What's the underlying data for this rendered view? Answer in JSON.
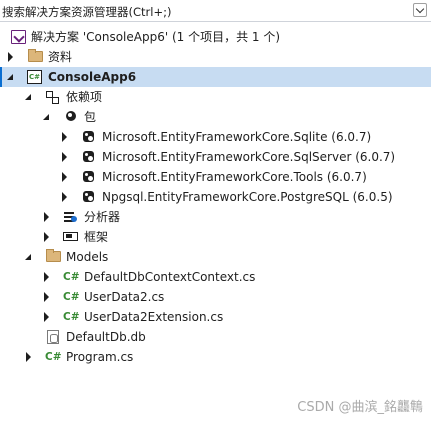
{
  "search": {
    "placeholder": "搜索解决方案资源管理器(Ctrl+;)"
  },
  "tree": {
    "solution": {
      "label": "解决方案 'ConsoleApp6' (1 个项目，共 1 个)"
    },
    "ziliao": {
      "label": "资料"
    },
    "project": {
      "label": "ConsoleApp6"
    },
    "deps": {
      "label": "依赖项"
    },
    "packages": {
      "label": "包",
      "items": [
        "Microsoft.EntityFrameworkCore.Sqlite (6.0.7)",
        "Microsoft.EntityFrameworkCore.SqlServer (6.0.7)",
        "Microsoft.EntityFrameworkCore.Tools (6.0.7)",
        "Npgsql.EntityFrameworkCore.PostgreSQL (6.0.5)"
      ]
    },
    "analyzers": {
      "label": "分析器"
    },
    "frameworks": {
      "label": "框架"
    },
    "models": {
      "label": "Models",
      "items": [
        "DefaultDbContextContext.cs",
        "UserData2.cs",
        "UserData2Extension.cs"
      ]
    },
    "defaultdb": {
      "label": "DefaultDb.db"
    },
    "program": {
      "label": "Program.cs"
    },
    "cs_icon_text": "C#",
    "csproj_icon_text": "C#"
  },
  "watermark": "CSDN @曲滨_銘龘鶽",
  "colors": {
    "selection": "#c7dcf2",
    "accent": "#0a6ed1",
    "cs_green": "#388a34",
    "solution_purple": "#68217a",
    "folder": "#dcb67a"
  },
  "icons": [
    "chevron-down-icon",
    "solution-icon",
    "folder-icon",
    "csproj-icon",
    "dependencies-icon",
    "package-icon",
    "nuget-icon",
    "analyzer-icon",
    "framework-icon",
    "csharp-file-icon",
    "database-file-icon"
  ]
}
